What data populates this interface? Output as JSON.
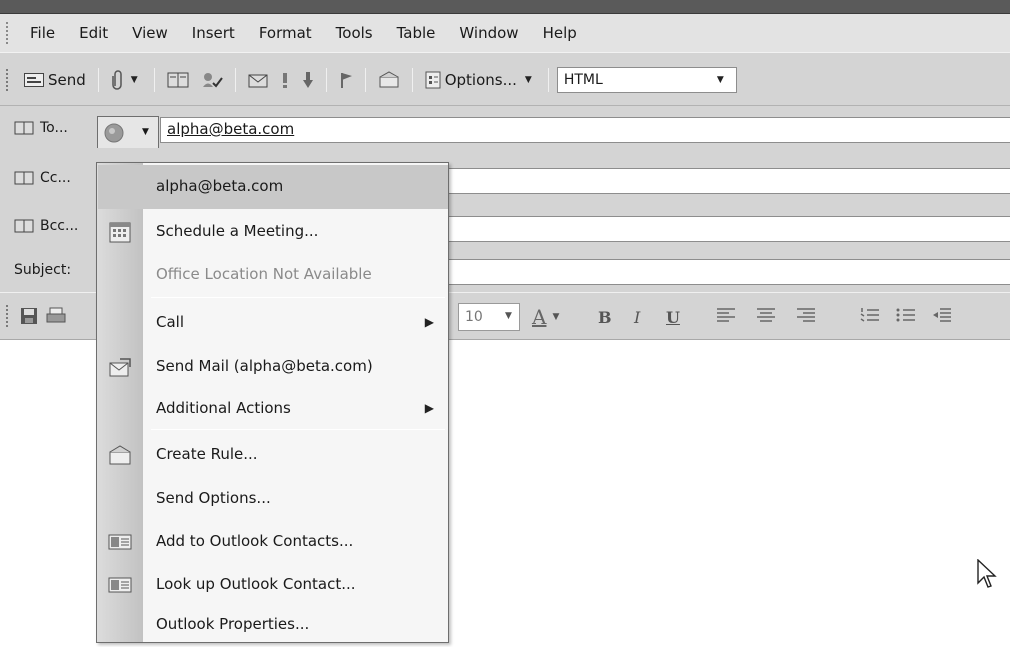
{
  "menubar": {
    "items": [
      {
        "label": "File"
      },
      {
        "label": "Edit"
      },
      {
        "label": "View"
      },
      {
        "label": "Insert"
      },
      {
        "label": "Format"
      },
      {
        "label": "Tools"
      },
      {
        "label": "Table"
      },
      {
        "label": "Window"
      },
      {
        "label": "Help"
      }
    ]
  },
  "toolbar": {
    "send_label": "Send",
    "options_label": "Options...",
    "format_value": "HTML"
  },
  "headers": {
    "to_label": "To...",
    "cc_label": "Cc...",
    "bcc_label": "Bcc...",
    "subject_label": "Subject:",
    "to_value": "alpha@beta.com"
  },
  "fmtbar": {
    "font_size": "10"
  },
  "context_menu": {
    "items": [
      {
        "label": "alpha@beta.com"
      },
      {
        "label": "Schedule a Meeting..."
      },
      {
        "label": "Office Location Not Available"
      },
      {
        "label": "Call"
      },
      {
        "label": "Send Mail (alpha@beta.com)"
      },
      {
        "label": "Additional Actions"
      },
      {
        "label": "Create Rule..."
      },
      {
        "label": "Send Options..."
      },
      {
        "label": "Add to Outlook Contacts..."
      },
      {
        "label": "Look up Outlook Contact..."
      },
      {
        "label": "Outlook Properties..."
      }
    ]
  },
  "icons": {
    "grip": "grip-icon",
    "send": "send-envelope-icon",
    "attach": "paperclip-icon",
    "address_book": "address-book-icon",
    "check_names": "check-names-icon",
    "importance_high": "exclamation-icon",
    "importance_low": "down-arrow-icon",
    "flag": "flag-icon",
    "rules": "rules-icon",
    "options": "options-icon",
    "presence": "presence-circle-icon",
    "calendar": "calendar-icon",
    "send_mail": "send-mail-icon",
    "contact_card": "contact-card-icon",
    "save": "save-icon",
    "print": "print-icon",
    "cursor": "mouse-pointer-icon"
  },
  "colors": {
    "toolbar_bg": "#d4d4d4",
    "menu_bg": "#f6f6f6",
    "highlight": "#c8c8c8",
    "disabled_text": "#8a8a8a"
  }
}
